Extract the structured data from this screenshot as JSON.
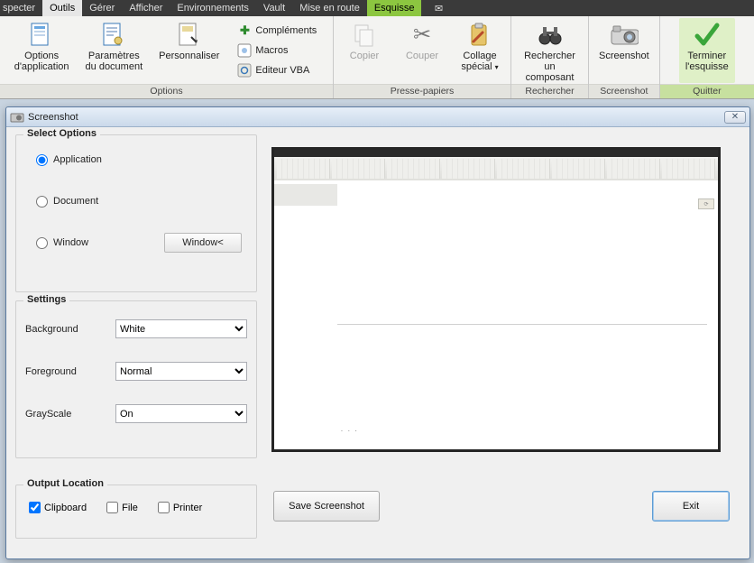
{
  "menu": {
    "items": [
      "specter",
      "Outils",
      "Gérer",
      "Afficher",
      "Environnements",
      "Vault",
      "Mise en route",
      "Esquisse"
    ]
  },
  "ribbon": {
    "groups": {
      "options": {
        "label": "Options",
        "app_options_l1": "Options",
        "app_options_l2": "d'application",
        "doc_params_l1": "Paramètres",
        "doc_params_l2": "du document",
        "customize": "Personnaliser",
        "addins": "Compléments",
        "macros": "Macros",
        "vba": "Editeur VBA"
      },
      "clipboard": {
        "label": "Presse-papiers",
        "copy": "Copier",
        "cut": "Couper",
        "paste_l1": "Collage",
        "paste_l2": "spécial"
      },
      "search": {
        "label": "Rechercher",
        "find_l1": "Rechercher",
        "find_l2": "un composant"
      },
      "screenshot": {
        "label": "Screenshot",
        "btn": "Screenshot"
      },
      "quit": {
        "label": "Quitter",
        "finish_l1": "Terminer",
        "finish_l2": "l'esquisse"
      }
    }
  },
  "dialog": {
    "title": "Screenshot",
    "close_glyph": "✕",
    "select_options": {
      "legend": "Select Options",
      "application": "Application",
      "document": "Document",
      "window": "Window",
      "window_btn": "Window<"
    },
    "settings": {
      "legend": "Settings",
      "background_label": "Background",
      "background_value": "White",
      "foreground_label": "Foreground",
      "foreground_value": "Normal",
      "grayscale_label": "GrayScale",
      "grayscale_value": "On"
    },
    "output": {
      "legend": "Output Location",
      "clipboard": "Clipboard",
      "file": "File",
      "printer": "Printer"
    },
    "save_btn": "Save Screenshot",
    "exit_btn": "Exit"
  }
}
